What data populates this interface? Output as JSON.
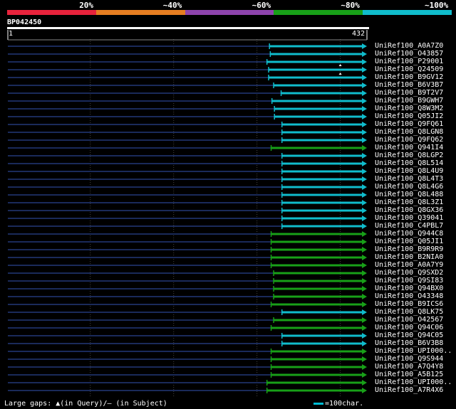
{
  "legend_top": {
    "labels": [
      "20%",
      "~40%",
      "~60%",
      "~80%",
      "~100%"
    ],
    "colors": [
      "#e8233c",
      "#e67e22",
      "#8e44ad",
      "#18a018",
      "#10bccc"
    ]
  },
  "query": {
    "id": "BP042450",
    "start": "1",
    "end": "432"
  },
  "footer": {
    "text": "Large gaps: ▲(in Query)/– (in Subject)",
    "scale_label": "=100char."
  },
  "chart_data": {
    "type": "alignment",
    "x_range": [
      1,
      432
    ],
    "rows": [
      {
        "name": "UniRef100_A0A7Z0",
        "start": 315,
        "color": "cyan"
      },
      {
        "name": "UniRef100_O43857",
        "start": 316,
        "color": "cyan"
      },
      {
        "name": "UniRef100_P29001",
        "start": 312,
        "color": "cyan"
      },
      {
        "name": "UniRef100_Q24509",
        "start": 314,
        "color": "cyan",
        "gap_marker": true
      },
      {
        "name": "UniRef100_B9GV12",
        "start": 314,
        "color": "cyan"
      },
      {
        "name": "UniRef100_B6V3B7",
        "start": 320,
        "color": "cyan"
      },
      {
        "name": "UniRef100_B9T2V7",
        "start": 329,
        "color": "cyan"
      },
      {
        "name": "UniRef100_B9GWH7",
        "start": 318,
        "color": "cyan"
      },
      {
        "name": "UniRef100_Q8W3M2",
        "start": 321,
        "color": "cyan"
      },
      {
        "name": "UniRef100_Q05JI2",
        "start": 321,
        "color": "cyan"
      },
      {
        "name": "UniRef100_Q9FQ61",
        "start": 330,
        "color": "cyan"
      },
      {
        "name": "UniRef100_Q8LGN8",
        "start": 330,
        "color": "cyan"
      },
      {
        "name": "UniRef100_Q9FQ62",
        "start": 330,
        "color": "cyan"
      },
      {
        "name": "UniRef100_Q941I4",
        "start": 317,
        "color": "green"
      },
      {
        "name": "UniRef100_Q8LGP2",
        "start": 330,
        "color": "cyan"
      },
      {
        "name": "UniRef100_Q8L514",
        "start": 330,
        "color": "cyan"
      },
      {
        "name": "UniRef100_Q8L4U9",
        "start": 330,
        "color": "cyan"
      },
      {
        "name": "UniRef100_Q8L4T3",
        "start": 330,
        "color": "cyan"
      },
      {
        "name": "UniRef100_Q8L4G6",
        "start": 330,
        "color": "cyan"
      },
      {
        "name": "UniRef100_Q8L488",
        "start": 330,
        "color": "cyan"
      },
      {
        "name": "UniRef100_Q8L3Z1",
        "start": 330,
        "color": "cyan"
      },
      {
        "name": "UniRef100_Q8GX36",
        "start": 330,
        "color": "cyan"
      },
      {
        "name": "UniRef100_Q39041",
        "start": 330,
        "color": "cyan"
      },
      {
        "name": "UniRef100_C4PBL7",
        "start": 330,
        "color": "cyan"
      },
      {
        "name": "UniRef100_Q944C8",
        "start": 317,
        "color": "green"
      },
      {
        "name": "UniRef100_Q05JI1",
        "start": 317,
        "color": "green"
      },
      {
        "name": "UniRef100_B9R9R9",
        "start": 317,
        "color": "green"
      },
      {
        "name": "UniRef100_B2NIA0",
        "start": 317,
        "color": "green"
      },
      {
        "name": "UniRef100_A0A7Y9",
        "start": 317,
        "color": "green"
      },
      {
        "name": "UniRef100_Q9SXD2",
        "start": 320,
        "color": "green"
      },
      {
        "name": "UniRef100_Q9SI83",
        "start": 320,
        "color": "green"
      },
      {
        "name": "UniRef100_Q94BX0",
        "start": 320,
        "color": "green"
      },
      {
        "name": "UniRef100_O43348",
        "start": 320,
        "color": "green"
      },
      {
        "name": "UniRef100_B9ICS6",
        "start": 317,
        "color": "green"
      },
      {
        "name": "UniRef100_Q8LK75",
        "start": 330,
        "color": "cyan"
      },
      {
        "name": "UniRef100_O42567",
        "start": 320,
        "color": "green"
      },
      {
        "name": "UniRef100_Q94C06",
        "start": 317,
        "color": "green"
      },
      {
        "name": "UniRef100_Q94C05",
        "start": 330,
        "color": "cyan"
      },
      {
        "name": "UniRef100_B6V3B8",
        "start": 330,
        "color": "cyan"
      },
      {
        "name": "UniRef100_UPI000..",
        "start": 317,
        "color": "green"
      },
      {
        "name": "UniRef100_Q9S944",
        "start": 317,
        "color": "green"
      },
      {
        "name": "UniRef100_A7Q4Y8",
        "start": 317,
        "color": "green"
      },
      {
        "name": "UniRef100_A5B125",
        "start": 317,
        "color": "green"
      },
      {
        "name": "UniRef100_UPI000..",
        "start": 312,
        "color": "green"
      },
      {
        "name": "UniRef100_A7R4X6",
        "start": 312,
        "color": "green"
      }
    ]
  }
}
